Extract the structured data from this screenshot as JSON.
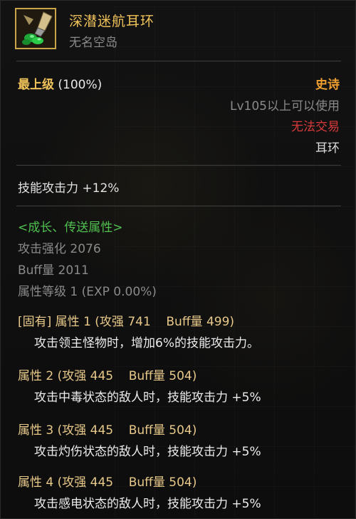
{
  "item": {
    "name": "深潜迷航耳环",
    "source": "无名空岛",
    "grade_label": "最上级",
    "grade_percent": "(100%)",
    "rarity": "史诗",
    "level_requirement": "Lv105以上可以使用",
    "trade_status": "无法交易",
    "slot": "耳环",
    "skill_attack": "技能攻击力  +12%",
    "icon": "earring-icon"
  },
  "growth": {
    "header": "<成长、传送属性>",
    "attack_enhance": "攻击强化 2076",
    "buff_amount": "Buff量 2011",
    "attribute_level": "属性等级 1 (EXP 0.00%)"
  },
  "options": [
    {
      "prefix": "[固有]",
      "title": " 属性 1 (攻强 741    Buff量 499)",
      "desc": "攻击领主怪物时，增加6%的技能攻击力。"
    },
    {
      "prefix": "",
      "title": "属性 2 (攻强 445    Buff量 504)",
      "desc": "攻击中毒状态的敌人时，技能攻击力 +5%"
    },
    {
      "prefix": "",
      "title": "属性 3 (攻强 445    Buff量 504)",
      "desc": "攻击灼伤状态的敌人时，技能攻击力 +5%"
    },
    {
      "prefix": "",
      "title": "属性 4 (攻强 445    Buff量 504)",
      "desc": "攻击感电状态的敌人时，技能攻击力 +5%"
    }
  ],
  "colors": {
    "title": "#f0c25a",
    "rarity": "#f0a030",
    "untradeable": "#d83a3a",
    "growth_header": "#50c050",
    "muted": "#8a8a8a"
  }
}
